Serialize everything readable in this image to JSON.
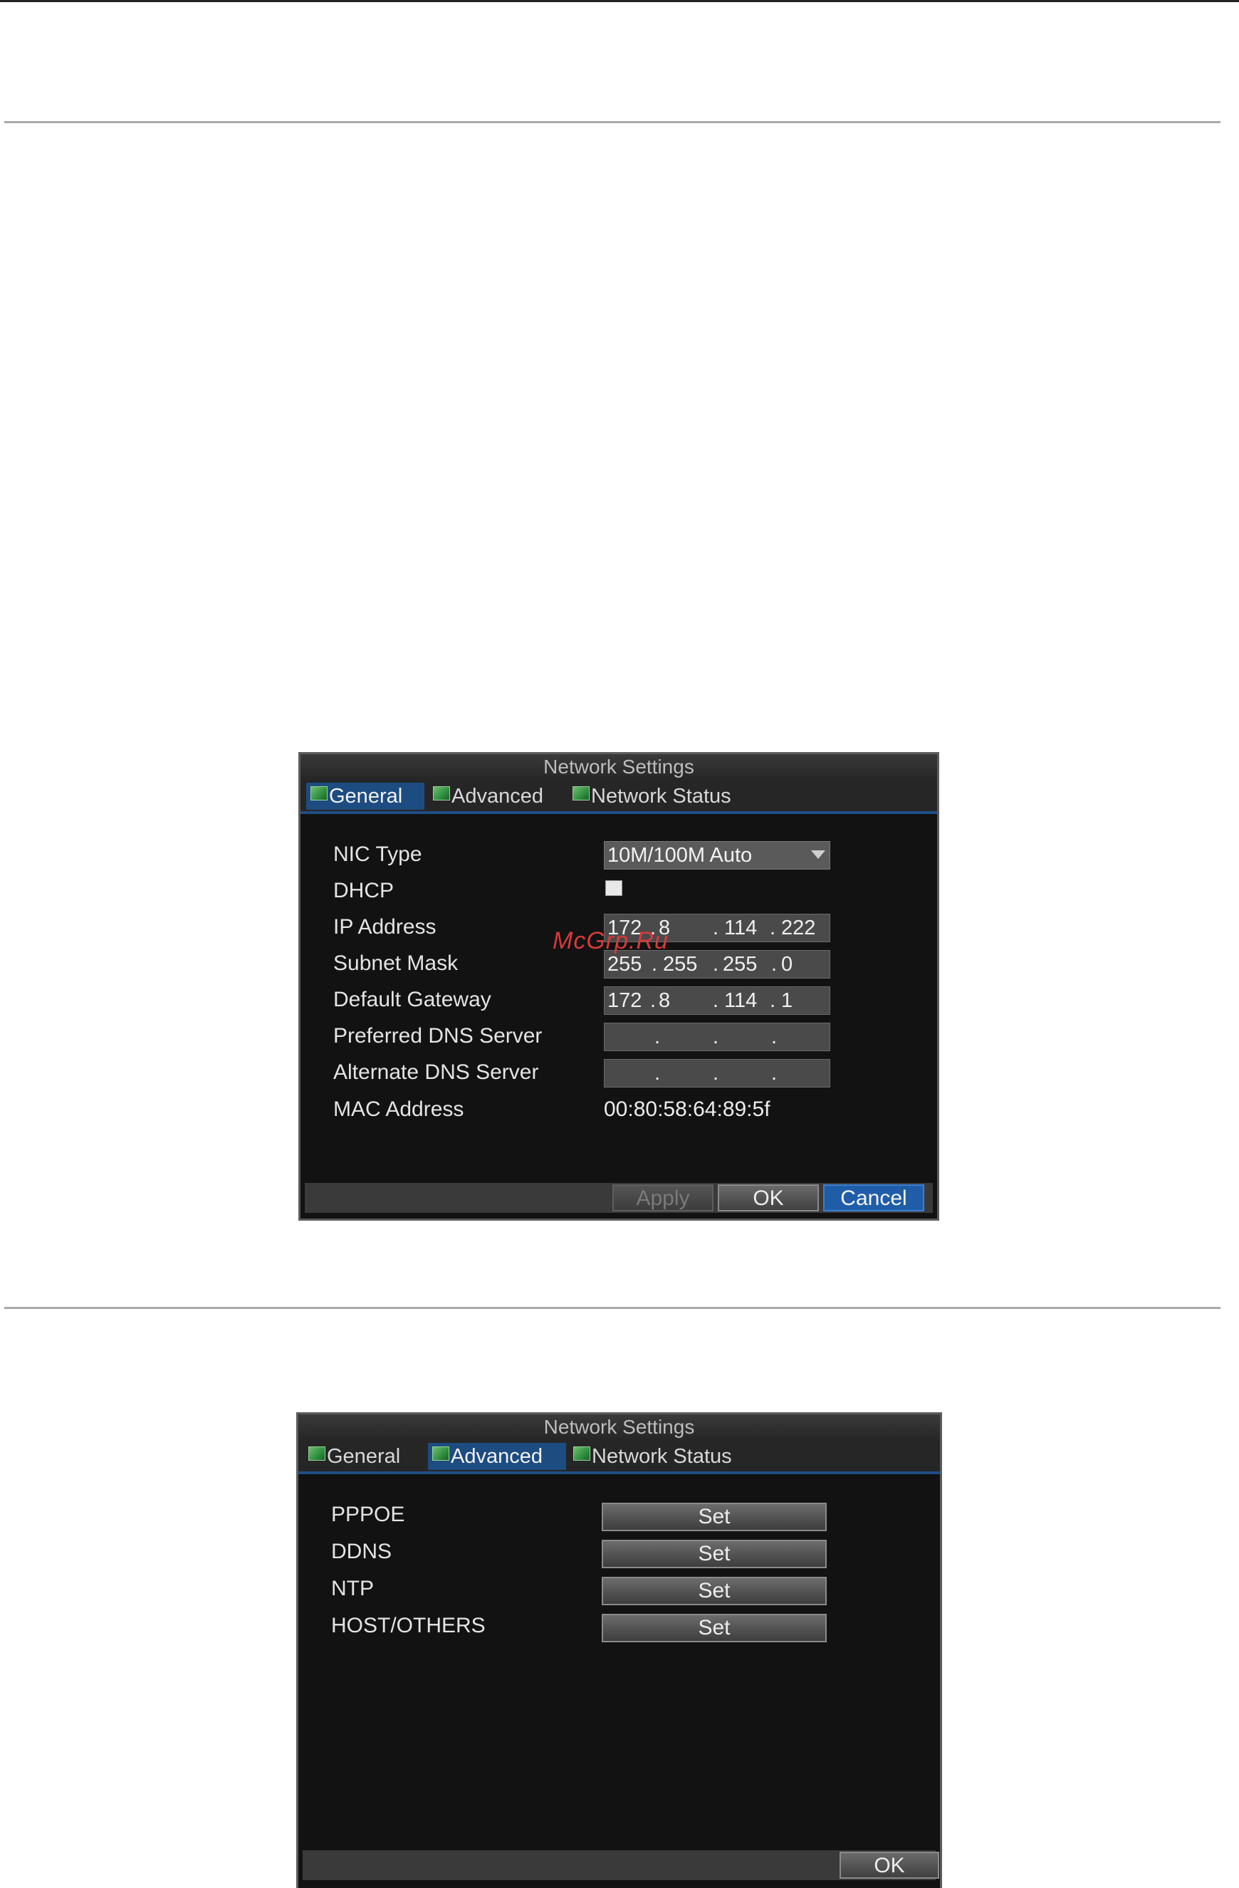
{
  "watermark": "McGrp.Ru",
  "dialog_general": {
    "title": "Network Settings",
    "tabs": [
      "General",
      "Advanced",
      "Network Status"
    ],
    "active_tab": "General",
    "fields": {
      "nic_type": {
        "label": "NIC Type",
        "value": "10M/100M Auto"
      },
      "dhcp": {
        "label": "DHCP",
        "checked": false
      },
      "ip_address": {
        "label": "IP Address",
        "octets": [
          "172",
          "8",
          "114",
          "222"
        ]
      },
      "subnet_mask": {
        "label": "Subnet Mask",
        "octets": [
          "255",
          "255",
          "255",
          "0"
        ]
      },
      "default_gateway": {
        "label": "Default Gateway",
        "octets": [
          "172",
          "8",
          "114",
          "1"
        ]
      },
      "preferred_dns": {
        "label": "Preferred DNS Server",
        "octets": [
          "",
          "",
          "",
          ""
        ]
      },
      "alternate_dns": {
        "label": "Alternate DNS Server",
        "octets": [
          "",
          "",
          "",
          ""
        ]
      },
      "mac_address": {
        "label": "MAC Address",
        "value": "00:80:58:64:89:5f"
      }
    },
    "buttons": {
      "apply": "Apply",
      "ok": "OK",
      "cancel": "Cancel"
    }
  },
  "dialog_advanced": {
    "title": "Network Settings",
    "tabs": [
      "General",
      "Advanced",
      "Network Status"
    ],
    "active_tab": "Advanced",
    "items": [
      {
        "label": "PPPOE",
        "button": "Set"
      },
      {
        "label": "DDNS",
        "button": "Set"
      },
      {
        "label": "NTP",
        "button": "Set"
      },
      {
        "label": "HOST/OTHERS",
        "button": "Set"
      }
    ],
    "buttons": {
      "ok": "OK"
    }
  },
  "colors": {
    "dialog_bg": "#121212",
    "tab_active": "#1d4c80",
    "cancel_button": "#1f5da8"
  }
}
